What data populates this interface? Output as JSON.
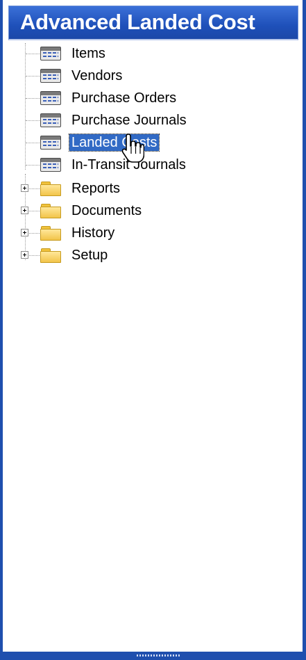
{
  "window": {
    "title": "Advanced Landed Cost"
  },
  "tree": {
    "items": [
      {
        "label": "Items",
        "icon": "form-icon"
      },
      {
        "label": "Vendors",
        "icon": "form-icon"
      },
      {
        "label": "Purchase Orders",
        "icon": "form-icon"
      },
      {
        "label": "Purchase Journals",
        "icon": "form-icon"
      },
      {
        "label": "Landed Costs",
        "icon": "form-icon",
        "selected": true
      },
      {
        "label": "In-Transit Journals",
        "icon": "form-icon"
      }
    ],
    "folders": [
      {
        "label": "Reports",
        "icon": "folder-icon",
        "expander": "plus-icon"
      },
      {
        "label": "Documents",
        "icon": "folder-icon",
        "expander": "plus-icon"
      },
      {
        "label": "History",
        "icon": "folder-icon",
        "expander": "plus-icon"
      },
      {
        "label": "Setup",
        "icon": "folder-icon",
        "expander": "plus-icon"
      }
    ]
  },
  "colors": {
    "title_bar": "#1e50b9",
    "selection": "#316ac5",
    "folder": "#f2c44a"
  }
}
